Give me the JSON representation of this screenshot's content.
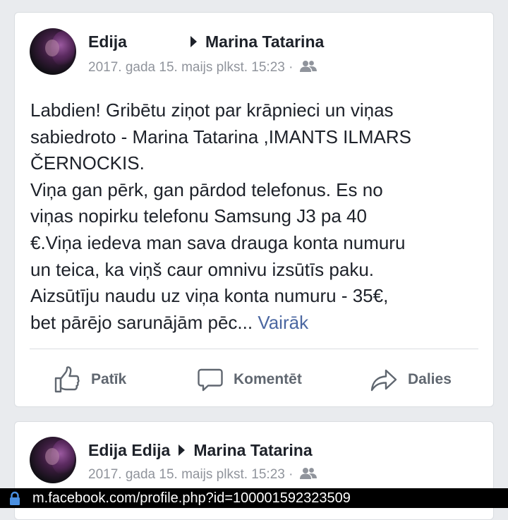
{
  "posts": [
    {
      "author": "Edija",
      "target": "Marina Tatarina",
      "timestamp": "2017. gada 15. maijs plkst. 15:23 ·",
      "privacy_icon": "friends-icon",
      "text_lines": [
        "Labdien! Gribētu ziņot par krāpnieci un viņas",
        "sabiedroto - Marina Tatarina ,IMANTS ILMARS",
        "ČERNOCKIS.",
        "Viņa gan pērk, gan pārdod telefonus. Es no",
        "viņas nopirku telefonu Samsung J3 pa 40",
        "€.Viņa iedeva man sava drauga konta numuru",
        "un teica, ka viņš caur omnivu izsūtīs paku.",
        "Aizsūtīju naudu uz viņa konta numuru - 35€,",
        "bet pārējo sarunājām pēc..."
      ],
      "more_label": "Vairāk",
      "actions": {
        "like": "Patīk",
        "comment": "Komentēt",
        "share": "Dalies"
      }
    },
    {
      "author": "Edija Edija",
      "target": "Marina Tatarina",
      "timestamp": "2017. gada 15. maijs plkst. 15:23 ·",
      "privacy_icon": "friends-icon"
    }
  ],
  "browser": {
    "url": "m.facebook.com/profile.php?id=100001592323509",
    "lock_icon": "lock-icon"
  },
  "colors": {
    "link": "#4b67a1",
    "muted": "#90949c",
    "lock": "#4a90e2"
  }
}
